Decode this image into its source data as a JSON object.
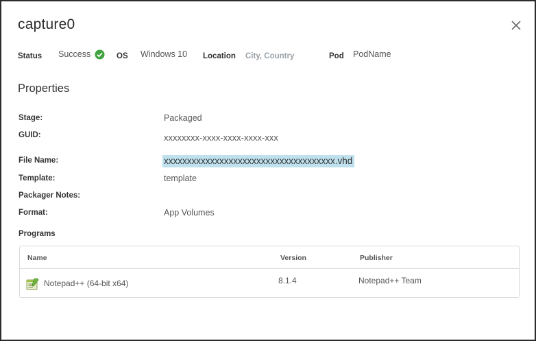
{
  "dialog": {
    "title": "capture0",
    "close_icon": "close-icon"
  },
  "meta": {
    "status_label": "Status",
    "status_value": "Success",
    "status_icon": "check-circle-icon",
    "status_color": "#3fa33f",
    "os_label": "OS",
    "os_value": "Windows 10",
    "location_label": "Location",
    "location_value": "City, Country",
    "pod_label": "Pod",
    "pod_value": "PodName"
  },
  "properties": {
    "title": "Properties",
    "stage_label": "Stage:",
    "stage_value": "Packaged",
    "guid_label": "GUID:",
    "guid_value": "xxxxxxxx-xxxx-xxxx-xxxx-xxx",
    "filename_label": "File Name:",
    "filename_value": "xxxxxxxxxxxxxxxxxxxxxxxxxxxxxxxxxxxxx.vhd",
    "template_label": "Template:",
    "template_value": "template",
    "notes_label": "Packager Notes:",
    "format_label": "Format:",
    "format_value": "App Volumes"
  },
  "programs": {
    "label": "Programs",
    "columns": [
      "Name",
      "Version",
      "Publisher"
    ],
    "rows": [
      {
        "name": "Notepad++ (64-bit x64)",
        "version": "8.1.4",
        "publisher": "Notepad++ Team",
        "icon": "notepad-plus-plus-icon"
      }
    ]
  },
  "colors": {
    "highlight": "#bfe1ed",
    "border": "#d8d8d8"
  }
}
